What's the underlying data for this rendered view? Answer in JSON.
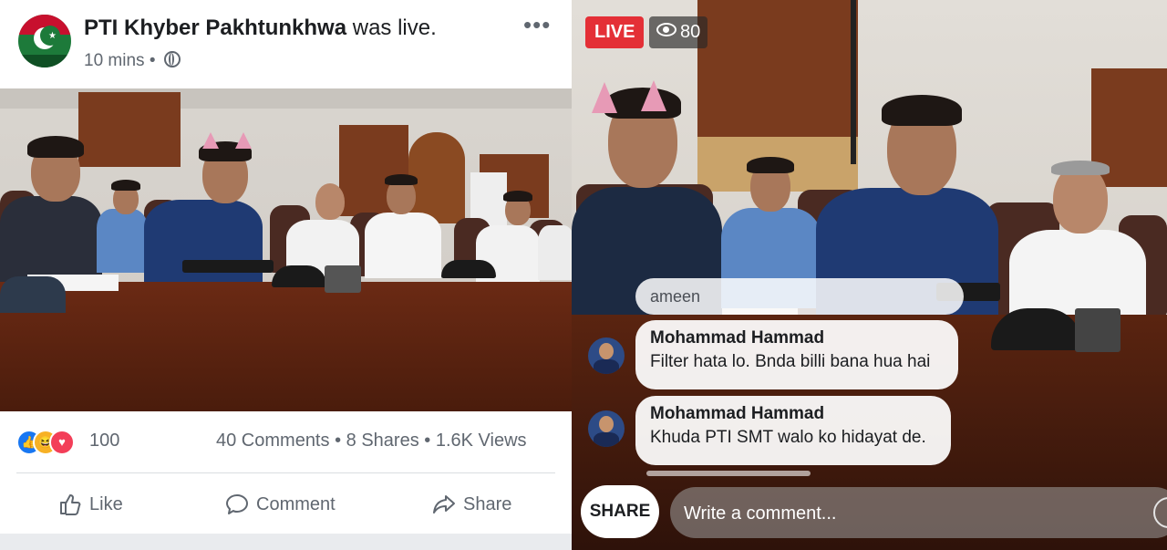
{
  "post": {
    "page_name": "PTI Khyber Pakhtunkhwa",
    "status_text": "was live.",
    "time": "10 mins",
    "separator": "•",
    "reaction_count": "100",
    "comments": "40 Comments",
    "shares": "8 Shares",
    "views": "1.6K Views",
    "actions": {
      "like": "Like",
      "comment": "Comment",
      "share": "Share"
    },
    "icons": {
      "privacy": "globe-icon",
      "more": "more-icon",
      "like": "thumbs-up-icon",
      "comment": "comment-icon",
      "share": "share-arrow-icon"
    }
  },
  "live": {
    "badge": "LIVE",
    "viewer_count": "80",
    "partial_comment": "ameen",
    "comments": [
      {
        "author": "Mohammad Hammad",
        "text": "Filter hata lo. Bnda billi bana hua hai"
      },
      {
        "author": "Mohammad Hammad",
        "text": "Khuda PTI SMT walo ko hidayat de."
      }
    ],
    "share_button": "SHARE",
    "comment_placeholder": "Write a comment..."
  },
  "colors": {
    "live_red": "#e42f36",
    "facebook_blue": "#1877f2",
    "love_red": "#f33e58",
    "haha_yellow": "#f7b125"
  }
}
